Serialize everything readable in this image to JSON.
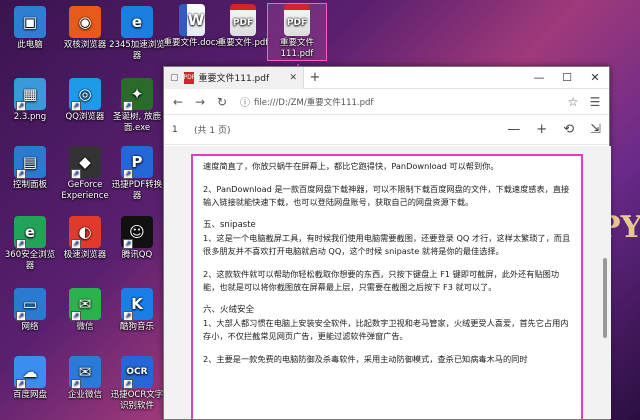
{
  "desktop": {
    "icons": [
      {
        "label": "此电脑",
        "glyph": "▣",
        "bg": "#2e7fd4"
      },
      {
        "label": "双核浏览器",
        "glyph": "◉",
        "bg": "#e65a1a"
      },
      {
        "label": "2345加速浏览器",
        "glyph": "e",
        "bg": "#1a7fe0"
      },
      {
        "label": "重要文件.docx",
        "glyph": "W",
        "type": "doc"
      },
      {
        "label": "重要文件.pdf",
        "glyph": "PDF",
        "type": "pdf"
      },
      {
        "label": "重要文件111.pdf",
        "glyph": "PDF",
        "type": "pdf"
      },
      {
        "label": "2.3.png",
        "glyph": "▦",
        "bg": "#3a9ad9"
      },
      {
        "label": "QQ浏览器",
        "glyph": "◎",
        "bg": "#1e9be8"
      },
      {
        "label": "圣诞树, 放鹿面.exe",
        "glyph": "✦",
        "bg": "#2a6a2a"
      },
      {
        "label": "控制面板",
        "glyph": "▤",
        "bg": "#2a7bd0"
      },
      {
        "label": "GeForce Experience",
        "glyph": "◆",
        "bg": "#333"
      },
      {
        "label": "迅捷PDF转换器",
        "glyph": "P",
        "bg": "#2566d8"
      },
      {
        "label": "360安全浏览器",
        "glyph": "e",
        "bg": "#22a35a"
      },
      {
        "label": "极速浏览器",
        "glyph": "◐",
        "bg": "#e03a2a"
      },
      {
        "label": "腾讯QQ",
        "glyph": "☺",
        "bg": "#111"
      },
      {
        "label": "网络",
        "glyph": "▭",
        "bg": "#2a7bd0"
      },
      {
        "label": "微信",
        "glyph": "✉",
        "bg": "#2bb24c"
      },
      {
        "label": "酷狗音乐",
        "glyph": "K",
        "bg": "#1a7ee6"
      },
      {
        "label": "百度网盘",
        "glyph": "☁",
        "bg": "#3b8df0"
      },
      {
        "label": "企业微信",
        "glyph": "✉",
        "bg": "#2a7ad8"
      },
      {
        "label": "迅捷OCR文字识别软件",
        "glyph": "OCR",
        "bg": "#2566d8"
      }
    ]
  },
  "window": {
    "tab_title": "重要文件111.pdf",
    "tab_close": "✕",
    "new_tab": "+",
    "btn_min": "—",
    "btn_max": "☐",
    "btn_close": "✕",
    "nav_back": "←",
    "nav_forward": "→",
    "nav_refresh": "↻",
    "address": "file:///D:/ZM/重要文件111.pdf",
    "fav_icon": "☆",
    "read_icon": "☰",
    "page_number": "1",
    "page_count": "(共 1 页)",
    "zoom_out": "—",
    "zoom_in": "+",
    "fit_icon": "⟲",
    "rotate_icon": "⇲"
  },
  "document": {
    "p0": "速度简直了，你放只蜗牛在屏幕上，都比它跑得快，PanDownload 可以帮到你。",
    "p1": "2、PanDownload 是一款百度网盘下载神器，可以不限制下载百度网盘的文件，下载速度感表，直接输入链接就能快速下载，也可以登陆网盘账号，获取自己的网盘资源下载。",
    "h5": "五、snipaste",
    "p2": "1、这是一个电脑截屏工具，有时候我们使用电脑需要截图，还要登录 QQ 才行，这样太繁琐了，而且很多朋友并不喜欢打开电脑就启动 QQ，这个时候 snipaste 就将是你的最佳选择。",
    "p3": "2、这款软件就可以帮助你轻松截取你想要的东西，只按下键盘上 F1 键即可截屏，此外还有贴图功能，也就是可以将你截图放在屏幕最上层，只需要在截图之后按下 F3 就可以了。",
    "h6": "六、火绒安全",
    "p4": "1、大部人都习惯在电脑上安装安全软件，比起数字卫视和老马管家，火绒更受人喜爱，首先它占用内存小，不仅拦截常见网页广告，更能过滤软件弹窗广告。",
    "p5": "2、主要是一款免费的电脑防御及杀毒软件，采用主动防御模式，查杀已知病毒木马的同时"
  }
}
